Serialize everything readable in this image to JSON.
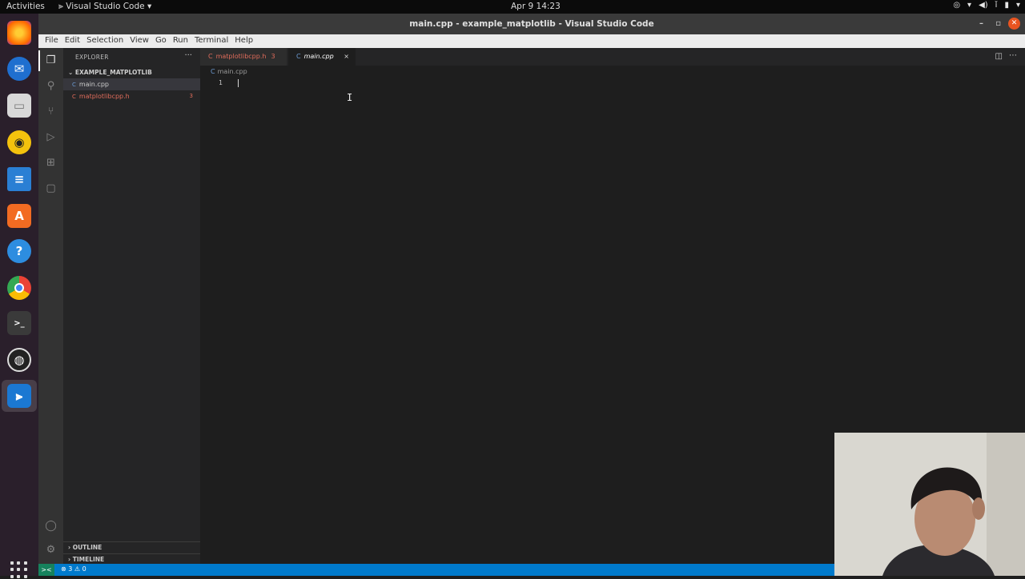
{
  "topbar": {
    "activities": "Activities",
    "app_name": "Visual Studio Code",
    "app_menu_arrow": "▾",
    "clock": "Apr 9  14:23",
    "tray_icons": [
      "chrome-tray-icon",
      "wifi-icon",
      "volume-icon",
      "microphone-icon",
      "battery-icon",
      "system-menu-arrow-icon"
    ]
  },
  "dock": {
    "apps": [
      "firefox-icon",
      "thunderbird-icon",
      "files-icon",
      "rhythmbox-icon",
      "libreoffice-writer-icon",
      "software-center-icon",
      "help-icon",
      "chrome-icon",
      "terminal-icon",
      "obs-icon",
      "vscode-icon"
    ],
    "show_apps": "show-applications-icon"
  },
  "window": {
    "title": "main.cpp - example_matplotlib - Visual Studio Code"
  },
  "menu": [
    "File",
    "Edit",
    "Selection",
    "View",
    "Go",
    "Run",
    "Terminal",
    "Help"
  ],
  "sidebar": {
    "header": "EXPLORER",
    "more": "···",
    "folder": "EXAMPLE_MATPLOTLIB",
    "files": [
      {
        "name": "main.cpp",
        "icon": "C",
        "badge": "",
        "color": "#cccccc"
      },
      {
        "name": "matplotlibcpp.h",
        "icon": "C",
        "badge": "3",
        "color": "#e06c5b"
      }
    ],
    "outline": "OUTLINE",
    "timeline": "TIMELINE"
  },
  "tabs": [
    {
      "label": "matplotlibcpp.h",
      "icon": "C",
      "badge": "3"
    },
    {
      "label": "main.cpp",
      "icon": "C",
      "close": "×"
    }
  ],
  "breadcrumb": {
    "icon": "C",
    "file": "main.cpp"
  },
  "editor": {
    "line_number": "1",
    "content": ""
  },
  "statusbar": {
    "remote": "><",
    "problems": "⊗ 3 ⚠ 0"
  }
}
